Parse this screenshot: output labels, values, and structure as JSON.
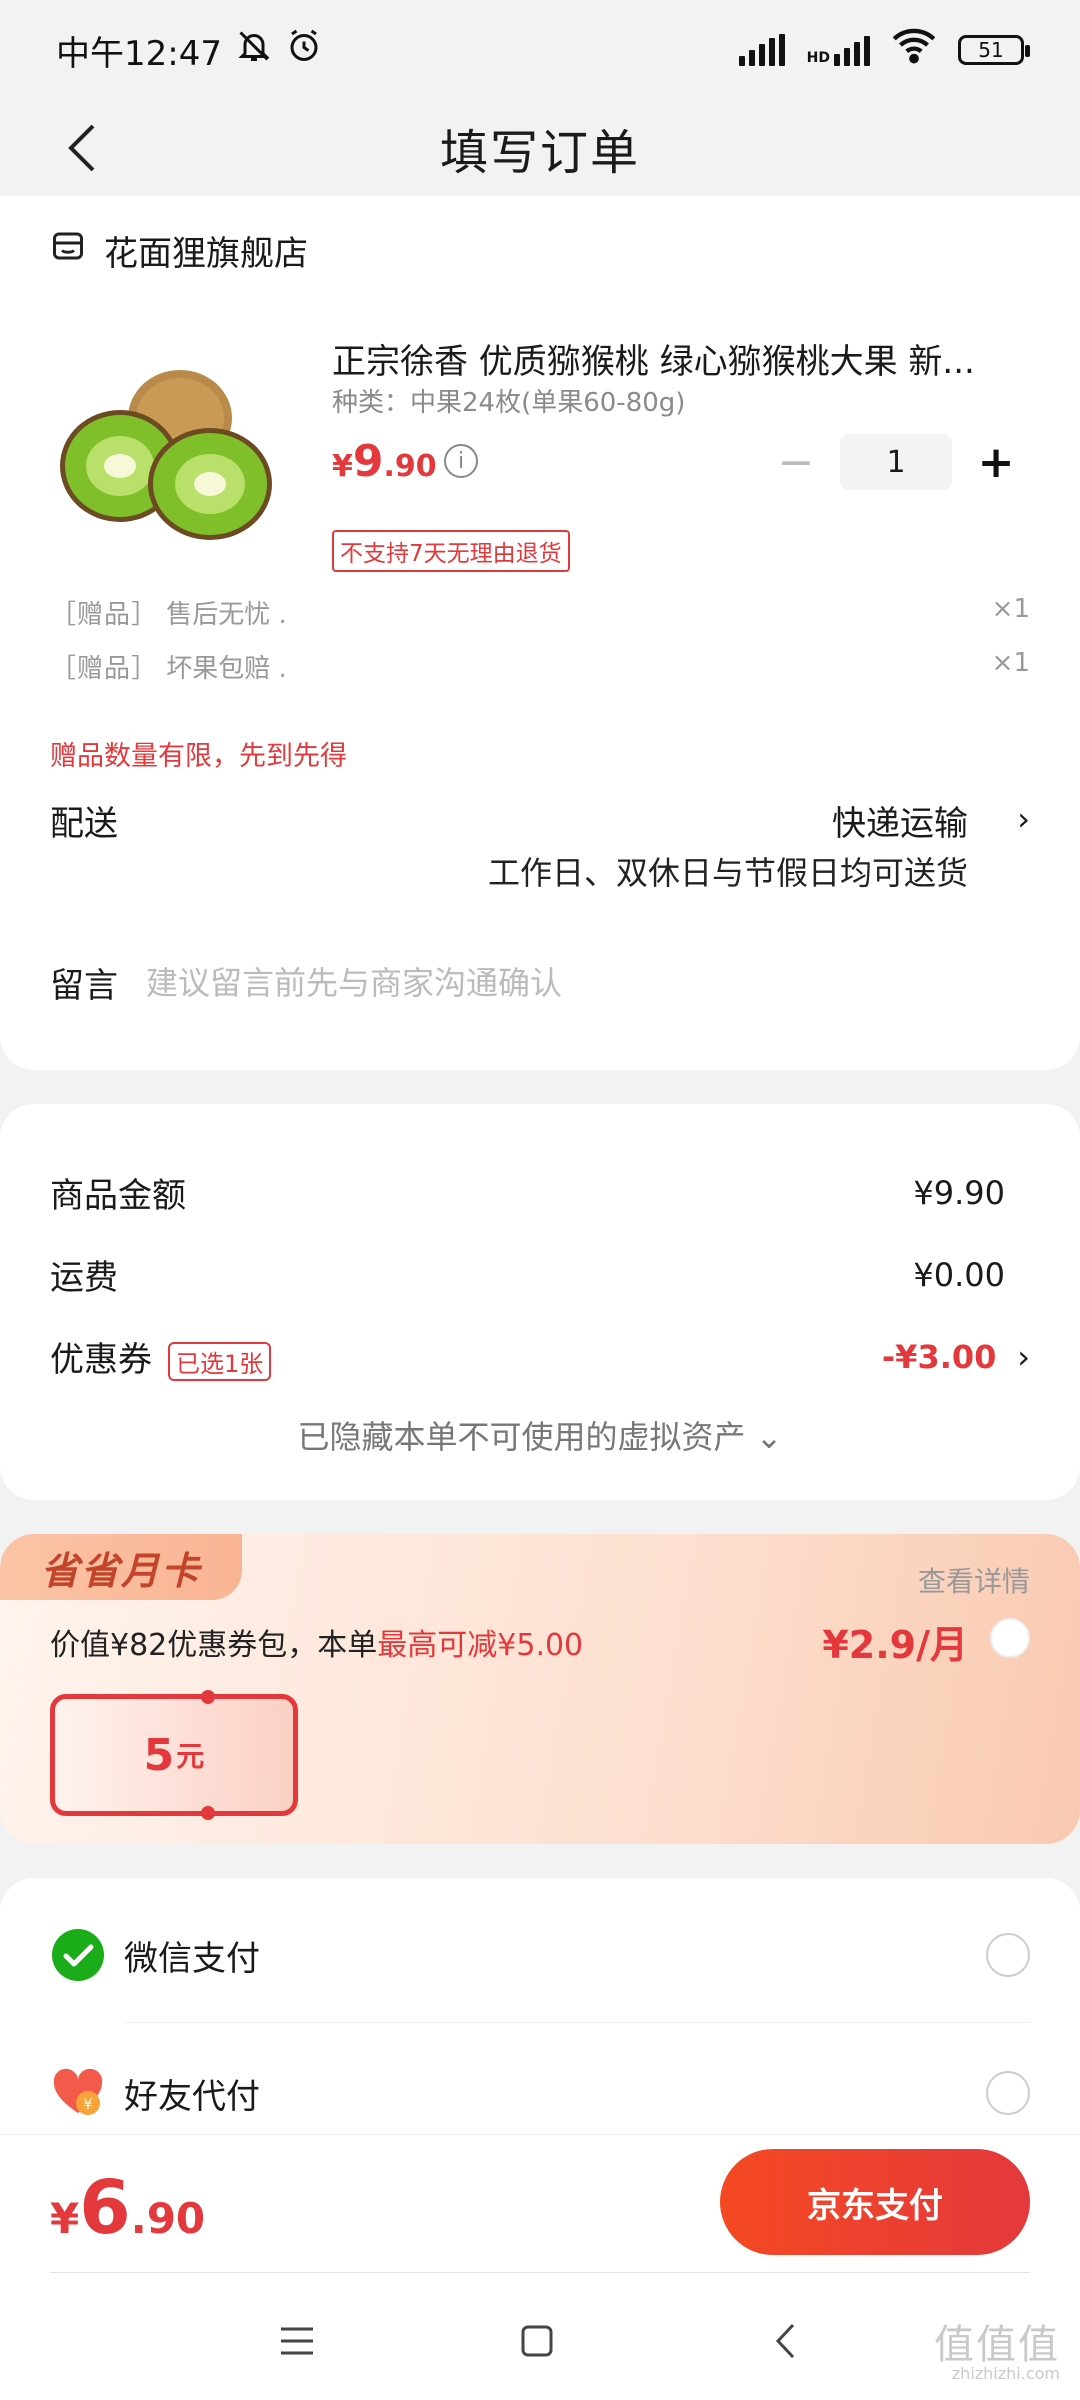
{
  "status_bar": {
    "time": "中午12:47",
    "battery": "51",
    "network": "HD"
  },
  "header": {
    "title": "填写订单"
  },
  "shop": {
    "name": "花面狸旗舰店"
  },
  "product": {
    "title": "正宗徐香 优质猕猴桃 绿心猕猴桃大果 新...",
    "spec": "种类：中果24枚(单果60-80g)",
    "price_currency": "¥",
    "price_int": "9",
    "price_dec": ".90",
    "quantity": "1",
    "minus": "−",
    "plus": "+",
    "tag": "不支持7天无理由退货"
  },
  "gifts": [
    {
      "tag": "［赠品］",
      "name": "售后无忧 .",
      "qty": "×1"
    },
    {
      "tag": "［赠品］",
      "name": "坏果包赔 .",
      "qty": "×1"
    }
  ],
  "gift_note": "赠品数量有限，先到先得",
  "delivery": {
    "label": "配送",
    "value": "快递运输",
    "sub": "工作日、双休日与节假日均可送货",
    "chevron": "›"
  },
  "message": {
    "label": "留言",
    "placeholder": "建议留言前先与商家沟通确认"
  },
  "summary": {
    "goods_label": "商品金额",
    "goods_amount": "¥9.90",
    "shipping_label": "运费",
    "shipping_amount": "¥0.00",
    "coupon_label": "优惠券",
    "coupon_badge": "已选1张",
    "coupon_amount": "-¥3.00",
    "coupon_chevron": "›",
    "hidden_note": "已隐藏本单不可使用的虚拟资产 ⌄"
  },
  "monthly_card": {
    "badge": "省省月卡",
    "detail": "查看详情",
    "desc_prefix": "价值¥82优惠券包，本单",
    "desc_highlight": "最高可减¥5.00",
    "price": "¥2.9/月",
    "ticket_value": "5",
    "ticket_unit": "元"
  },
  "payment": {
    "wechat_label": "微信支付",
    "friend_label": "好友代付"
  },
  "bottom": {
    "total_currency": "¥",
    "total_int": "6",
    "total_dec": ".90",
    "pay_button": "京东支付"
  },
  "watermark": {
    "text": "值值值",
    "sub": "zhizhizhi.com"
  },
  "colors": {
    "accent": "#e4393c",
    "wechat": "#1aad19"
  }
}
